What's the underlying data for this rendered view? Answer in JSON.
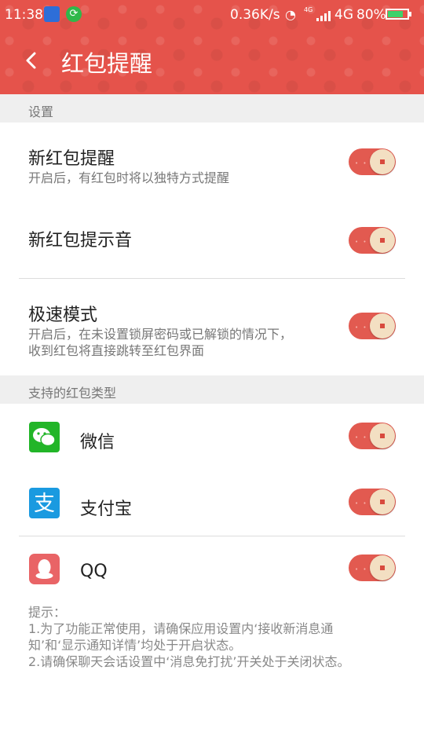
{
  "status_bar": {
    "time": "11:38",
    "net_speed": "0.36K/s",
    "small_net_label": "4G",
    "net_type": "4G",
    "battery_pct": "80%",
    "battery_level": 0.8,
    "app_icons": [
      "sim-card-icon",
      "green-app-icon"
    ]
  },
  "header": {
    "title": "红包提醒",
    "back_icon": "back-arrow-icon",
    "accent": "#e5534b"
  },
  "settings": {
    "section_label": "设置",
    "items": [
      {
        "title": "新红包提醒",
        "desc": "开启后，有红包时将以独特方式提醒",
        "enabled": true
      },
      {
        "title": "新红包提示音",
        "desc": "",
        "enabled": true
      },
      {
        "title": "极速模式",
        "desc_line1": "开启后，在未设置锁屏密码或已解锁的情况下，",
        "desc_line2": "收到红包将直接跳转至红包界面",
        "enabled": true
      }
    ]
  },
  "types": {
    "section_label": "支持的红包类型",
    "items": [
      {
        "name": "微信",
        "icon": "wechat-icon",
        "enabled": true
      },
      {
        "name": "支付宝",
        "icon": "alipay-icon",
        "enabled": true
      },
      {
        "name": "QQ",
        "icon": "qq-icon",
        "enabled": true
      }
    ]
  },
  "tips": {
    "label": "提示：",
    "line1": "1.为了功能正常使用，请确保应用设置内‘接收新消息通",
    "line2": "知’和‘显示通知详情’均处于开启状态。",
    "line3": "2.请确保聊天会话设置中‘消息免打扰’开关处于关闭状态。"
  },
  "colors": {
    "toggle_on": "#e25a50",
    "knob": "#f3dfc2",
    "wechat": "#22b528",
    "alipay": "#1a9ae0",
    "qq": "#e96466"
  }
}
